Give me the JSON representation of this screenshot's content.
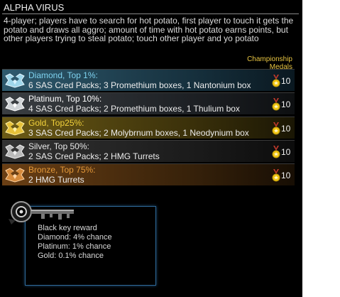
{
  "event": {
    "title": "ALPHA VIRUS",
    "description": "4-player; players have to search for hot potato, first player to touch it gets the potato and draws all aggro; amount of time with hot potato earns points, but other players trying to steal potato; touch other player and yo potato",
    "medals_header": "Championship Medals"
  },
  "tiers": [
    {
      "name": "Diamond, Top 1%:",
      "reward": "6 SAS Cred Packs; 3 Promethium boxes, 1 Nantonium box",
      "medals": "10",
      "color": "#7fd3f0"
    },
    {
      "name": "Platinum, Top 10%:",
      "reward": "4 SAS Cred Packs; 2 Promethium boxes, 1 Thulium box",
      "medals": "10",
      "color": "#ffffff"
    },
    {
      "name": "Gold, Top25%:",
      "reward": "3 SAS Cred Packs; 2 Molybrnum boxes, 1 Neodynium box",
      "medals": "10",
      "color": "#f2d23c"
    },
    {
      "name": "Silver, Top 50%:",
      "reward": "2 SAS Cred Packs; 2 HMG Turrets",
      "medals": "10",
      "color": "#e8e8e8"
    },
    {
      "name": "Bronze, Top 75%:",
      "reward": "2 HMG Turrets",
      "medals": "10",
      "color": "#e69a3a"
    }
  ],
  "black_key": {
    "icon": "black-key-icon",
    "lines": [
      "Black key reward",
      "Diamond: 4% chance",
      "Platinum: 1% chance",
      "Gold: 0.1% chance"
    ]
  }
}
